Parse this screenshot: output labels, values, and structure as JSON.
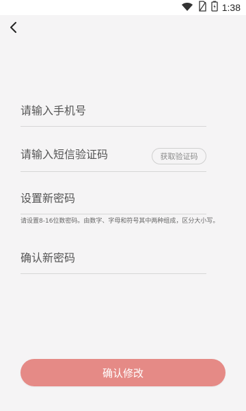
{
  "status_bar": {
    "time": "1:38"
  },
  "colors": {
    "background": "#f5f4f5",
    "accent": "#e58a86",
    "divider": "#d6d6d6",
    "text": "#555555"
  },
  "header": {
    "back_icon": "chevron-left-icon"
  },
  "form": {
    "phone_placeholder": "请输入手机号",
    "sms_code_placeholder": "请输入短信验证码",
    "get_code_button": "获取验证码",
    "new_password_placeholder": "设置新密码",
    "password_hint": "请设置8-16位数密码。由数字、字母和符号其中两种组成，区分大小写。",
    "confirm_password_placeholder": "确认新密码",
    "confirm_button": "确认修改"
  }
}
